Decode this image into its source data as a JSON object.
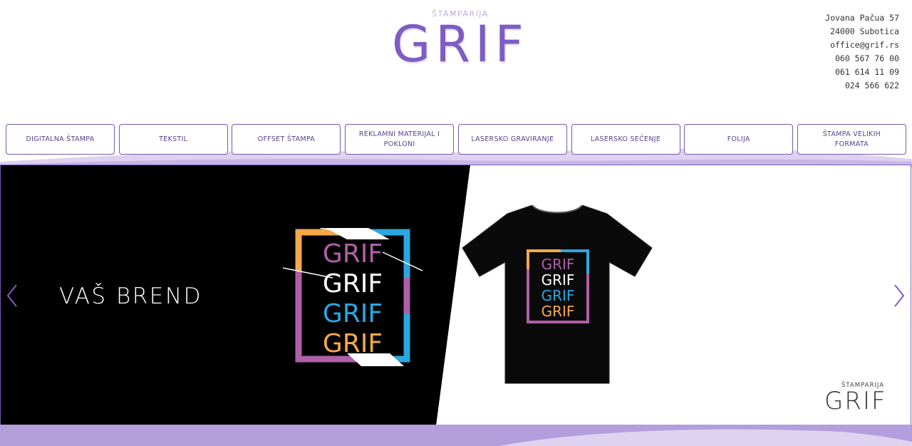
{
  "brand": {
    "small_label": "ŠTAMPARIJA",
    "name": "GRIF"
  },
  "contact": {
    "address": "Jovana Pačua 57",
    "city": "24000 Subotica",
    "email": "office@grif.rs",
    "phone1": "060 567 76 00",
    "phone2": "061 614 11 09",
    "phone3": "024 566 622"
  },
  "nav": {
    "items": [
      {
        "label": "DIGITALNA ŠTAMPA"
      },
      {
        "label": "TEKSTIL"
      },
      {
        "label": "OFFSET ŠTAMPA"
      },
      {
        "label": "REKLAMNI MATERIJAL I POKLONI"
      },
      {
        "label": "LASERSKO GRAVIRANJE"
      },
      {
        "label": "LASERSKO SEČENJE"
      },
      {
        "label": "FOLIJA"
      },
      {
        "label": "ŠTAMPA VELIKIH FORMATA"
      }
    ]
  },
  "slider": {
    "title": "VAŠ BREND",
    "art_words": [
      "GRIF",
      "GRIF",
      "GRIF",
      "GRIF"
    ],
    "shirt_words": [
      "GRIF",
      "GRIF",
      "GRIF",
      "GRIF"
    ],
    "corner_small": "ŠTAMPARIJA",
    "corner_big": "GRIF",
    "prev_icon": "chevron-left-icon",
    "next_icon": "chevron-right-icon"
  },
  "colors": {
    "accent": "#7e5cc4",
    "nav_border": "#7558b0",
    "wave": "#b39ddb",
    "art_pink": "#b05fa8",
    "art_blue": "#2aa7e0",
    "art_orange": "#f5a84a",
    "art_white": "#ffffff"
  }
}
